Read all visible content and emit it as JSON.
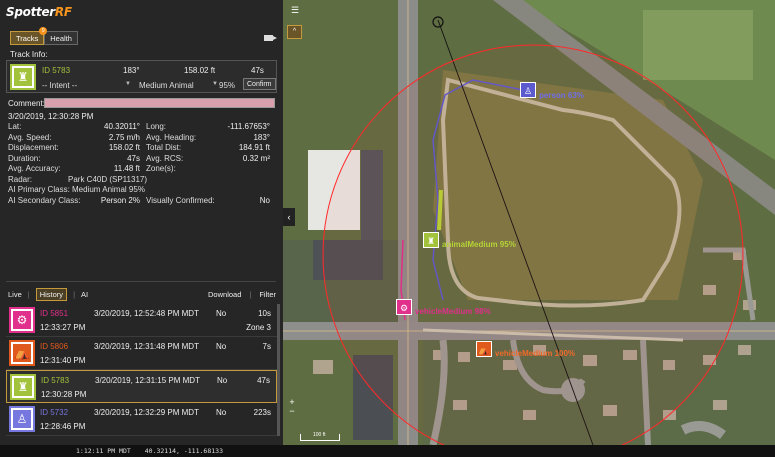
{
  "app": {
    "logo_a": "Spotter",
    "logo_b": "RF"
  },
  "tabs": {
    "tracks": "Tracks",
    "tracks_badge": "9",
    "health": "Health"
  },
  "track_info_title": "Track Info:",
  "current_track": {
    "id": "ID 5783",
    "heading": "183°",
    "distance": "158.02 ft",
    "duration": "47s",
    "intent": "-- Intent --",
    "classification": "Medium Animal",
    "confidence": "95%",
    "confirm": "Confirm"
  },
  "comment_label": "Comment:",
  "info": {
    "timestamp": "3/20/2019, 12:30:28 PM",
    "rows": [
      {
        "k": "Lat:",
        "v": "40.32011°",
        "k2": "Long:",
        "v2": "-111.67653°"
      },
      {
        "k": "Avg. Speed:",
        "v": "2.75 m/h",
        "k2": "Avg. Heading:",
        "v2": "183°"
      },
      {
        "k": "Displacement:",
        "v": "158.02 ft",
        "k2": "Total Dist:",
        "v2": "184.91 ft"
      },
      {
        "k": "Duration:",
        "v": "47s",
        "k2": "Avg. RCS:",
        "v2": "0.32 m²"
      },
      {
        "k": "Avg. Accuracy:",
        "v": "11.48 ft",
        "k2": "Zone(s):",
        "v2": ""
      }
    ],
    "radar": "Radar:",
    "radar_value": "Park C40D (SP11317)",
    "ai_primary": "AI Primary Class: Medium Animal 95%",
    "ai_secondary_label": "AI Secondary Class:",
    "ai_secondary_value": "Person 2%",
    "visually_confirmed_label": "Visually Confirmed:",
    "visually_confirmed_value": "No"
  },
  "history_tabs": {
    "live": "Live",
    "history": "History",
    "ai": "AI",
    "download": "Download",
    "filter": "Filter"
  },
  "history": [
    {
      "id": "ID 5851",
      "date": "3/20/2019, 12:52:48 PM MDT",
      "confirmed": "No",
      "duration": "10s",
      "time": "12:33:27 PM",
      "zone": "Zone 3",
      "color": "#e0308c",
      "icon": "vehicle-icon"
    },
    {
      "id": "ID 5806",
      "date": "3/20/2019, 12:31:48 PM MDT",
      "confirmed": "No",
      "duration": "7s",
      "time": "12:31:40 PM",
      "zone": "",
      "color": "#e05a1e",
      "icon": "car-icon"
    },
    {
      "id": "ID 5783",
      "date": "3/20/2019, 12:31:15 PM MDT",
      "confirmed": "No",
      "duration": "47s",
      "time": "12:30:28 PM",
      "zone": "",
      "color": "#a2c23c",
      "icon": "animal-icon"
    },
    {
      "id": "ID 5732",
      "date": "3/20/2019, 12:32:29 PM MDT",
      "confirmed": "No",
      "duration": "223s",
      "time": "12:28:46 PM",
      "zone": "",
      "color": "#7777e0",
      "icon": "person-icon"
    }
  ],
  "status": {
    "time": "1:12:11 PM MDT",
    "coords": "40.32114, -111.68133"
  },
  "map": {
    "labels": {
      "person": "person 63%",
      "animal": "animalMedium 95%",
      "vehicle1": "vehicleMedium 98%",
      "vehicle2": "vehicleMedium 100%"
    },
    "scale": "100 ft",
    "up_button": "^"
  }
}
